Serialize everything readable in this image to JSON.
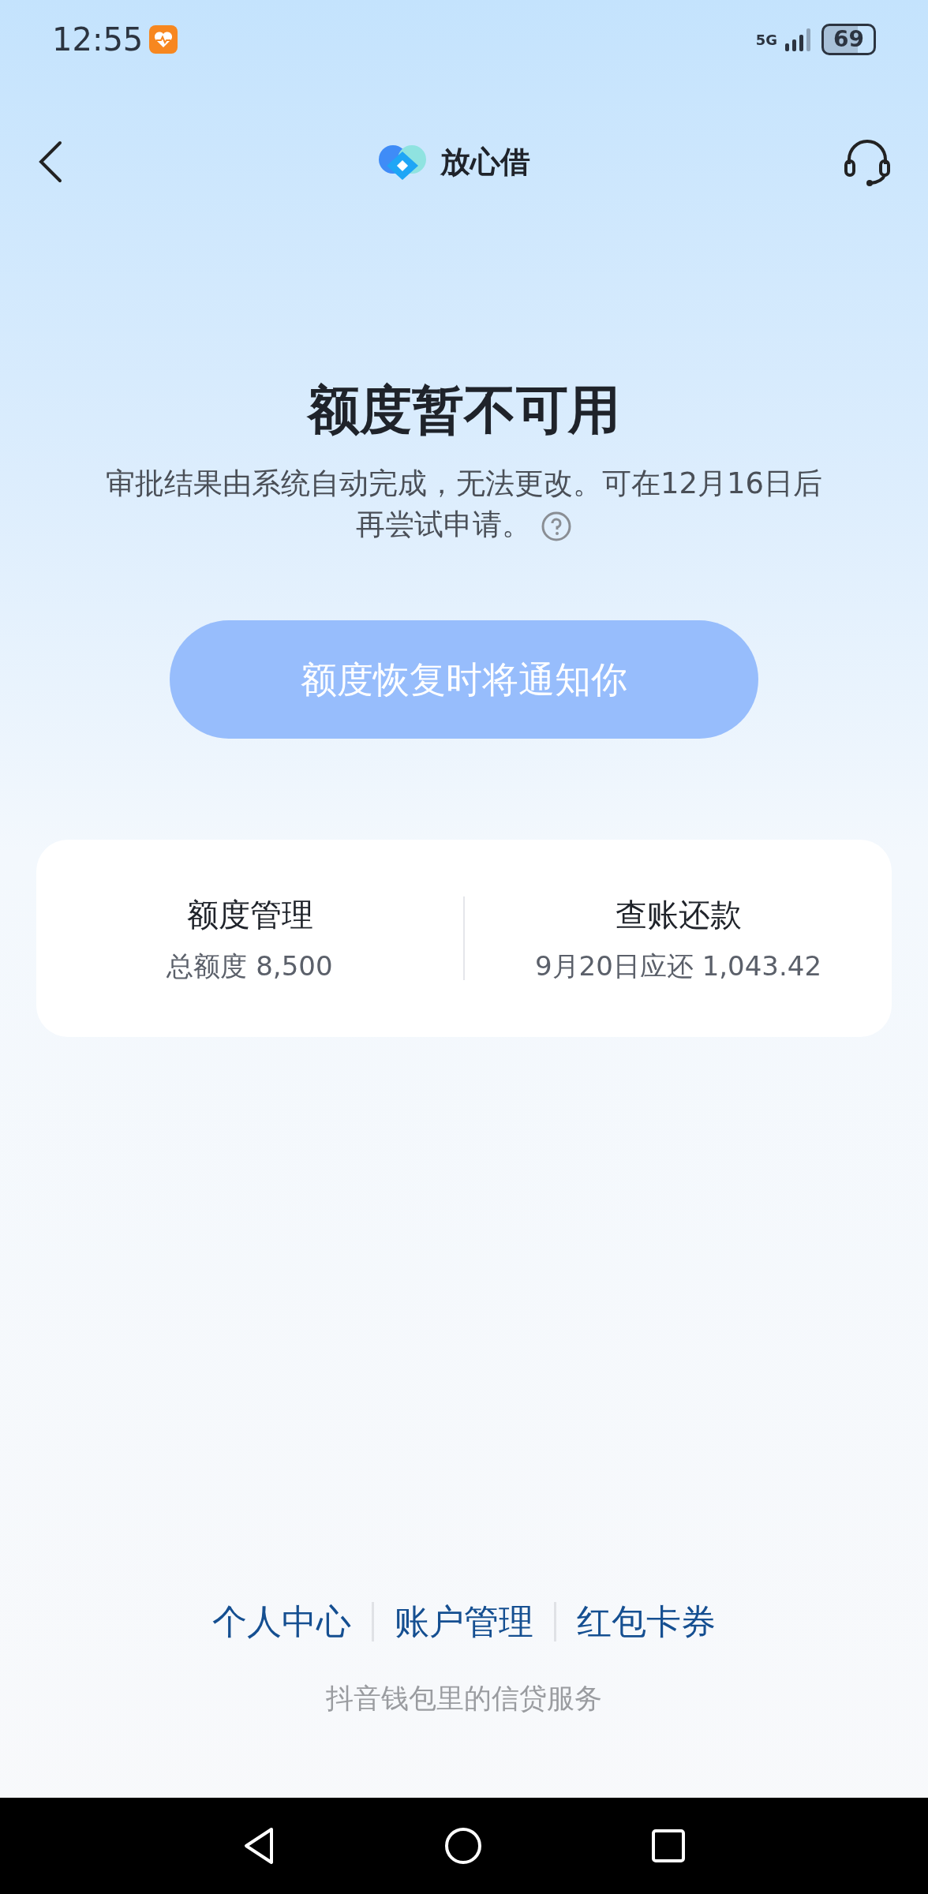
{
  "status_bar": {
    "time": "12:55",
    "network": "5G",
    "battery": "69"
  },
  "header": {
    "brand": "放心借"
  },
  "notice": {
    "title": "额度暂不可用",
    "message": "审批结果由系统自动完成，无法更改。可在12月16日后再尝试申请。"
  },
  "action_button": {
    "label": "额度恢复时将通知你",
    "disabled": true
  },
  "summary": [
    {
      "title": "额度管理",
      "detail": "总额度 8,500"
    },
    {
      "title": "查账还款",
      "detail": "9月20日应还 1,043.42"
    }
  ],
  "footer_links": [
    "个人中心",
    "账户管理",
    "红包卡券"
  ],
  "tagline": "抖音钱包里的信贷服务"
}
